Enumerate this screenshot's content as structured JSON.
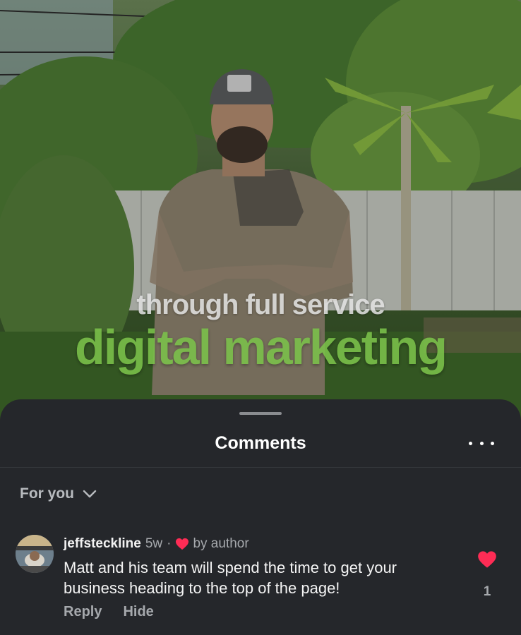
{
  "video": {
    "caption_line1": "through full service",
    "caption_line2": "digital marketing"
  },
  "comments_sheet": {
    "title": "Comments",
    "more_icon": "more-horizontal-icon",
    "filter": {
      "label": "For you",
      "icon": "chevron-down-icon"
    },
    "comments": [
      {
        "username": "jeffsteckline",
        "time": "5w",
        "separator": "·",
        "author_like_label": "by author",
        "text": "Matt and his team will spend the time to get your business heading to the top of the page!",
        "reply_label": "Reply",
        "hide_label": "Hide",
        "like_count": "1"
      }
    ]
  },
  "colors": {
    "sheet_bg": "#25272b",
    "heart_red": "#fe2c55",
    "muted_text": "#a6a9ad",
    "caption_green": "#7bc24a"
  }
}
